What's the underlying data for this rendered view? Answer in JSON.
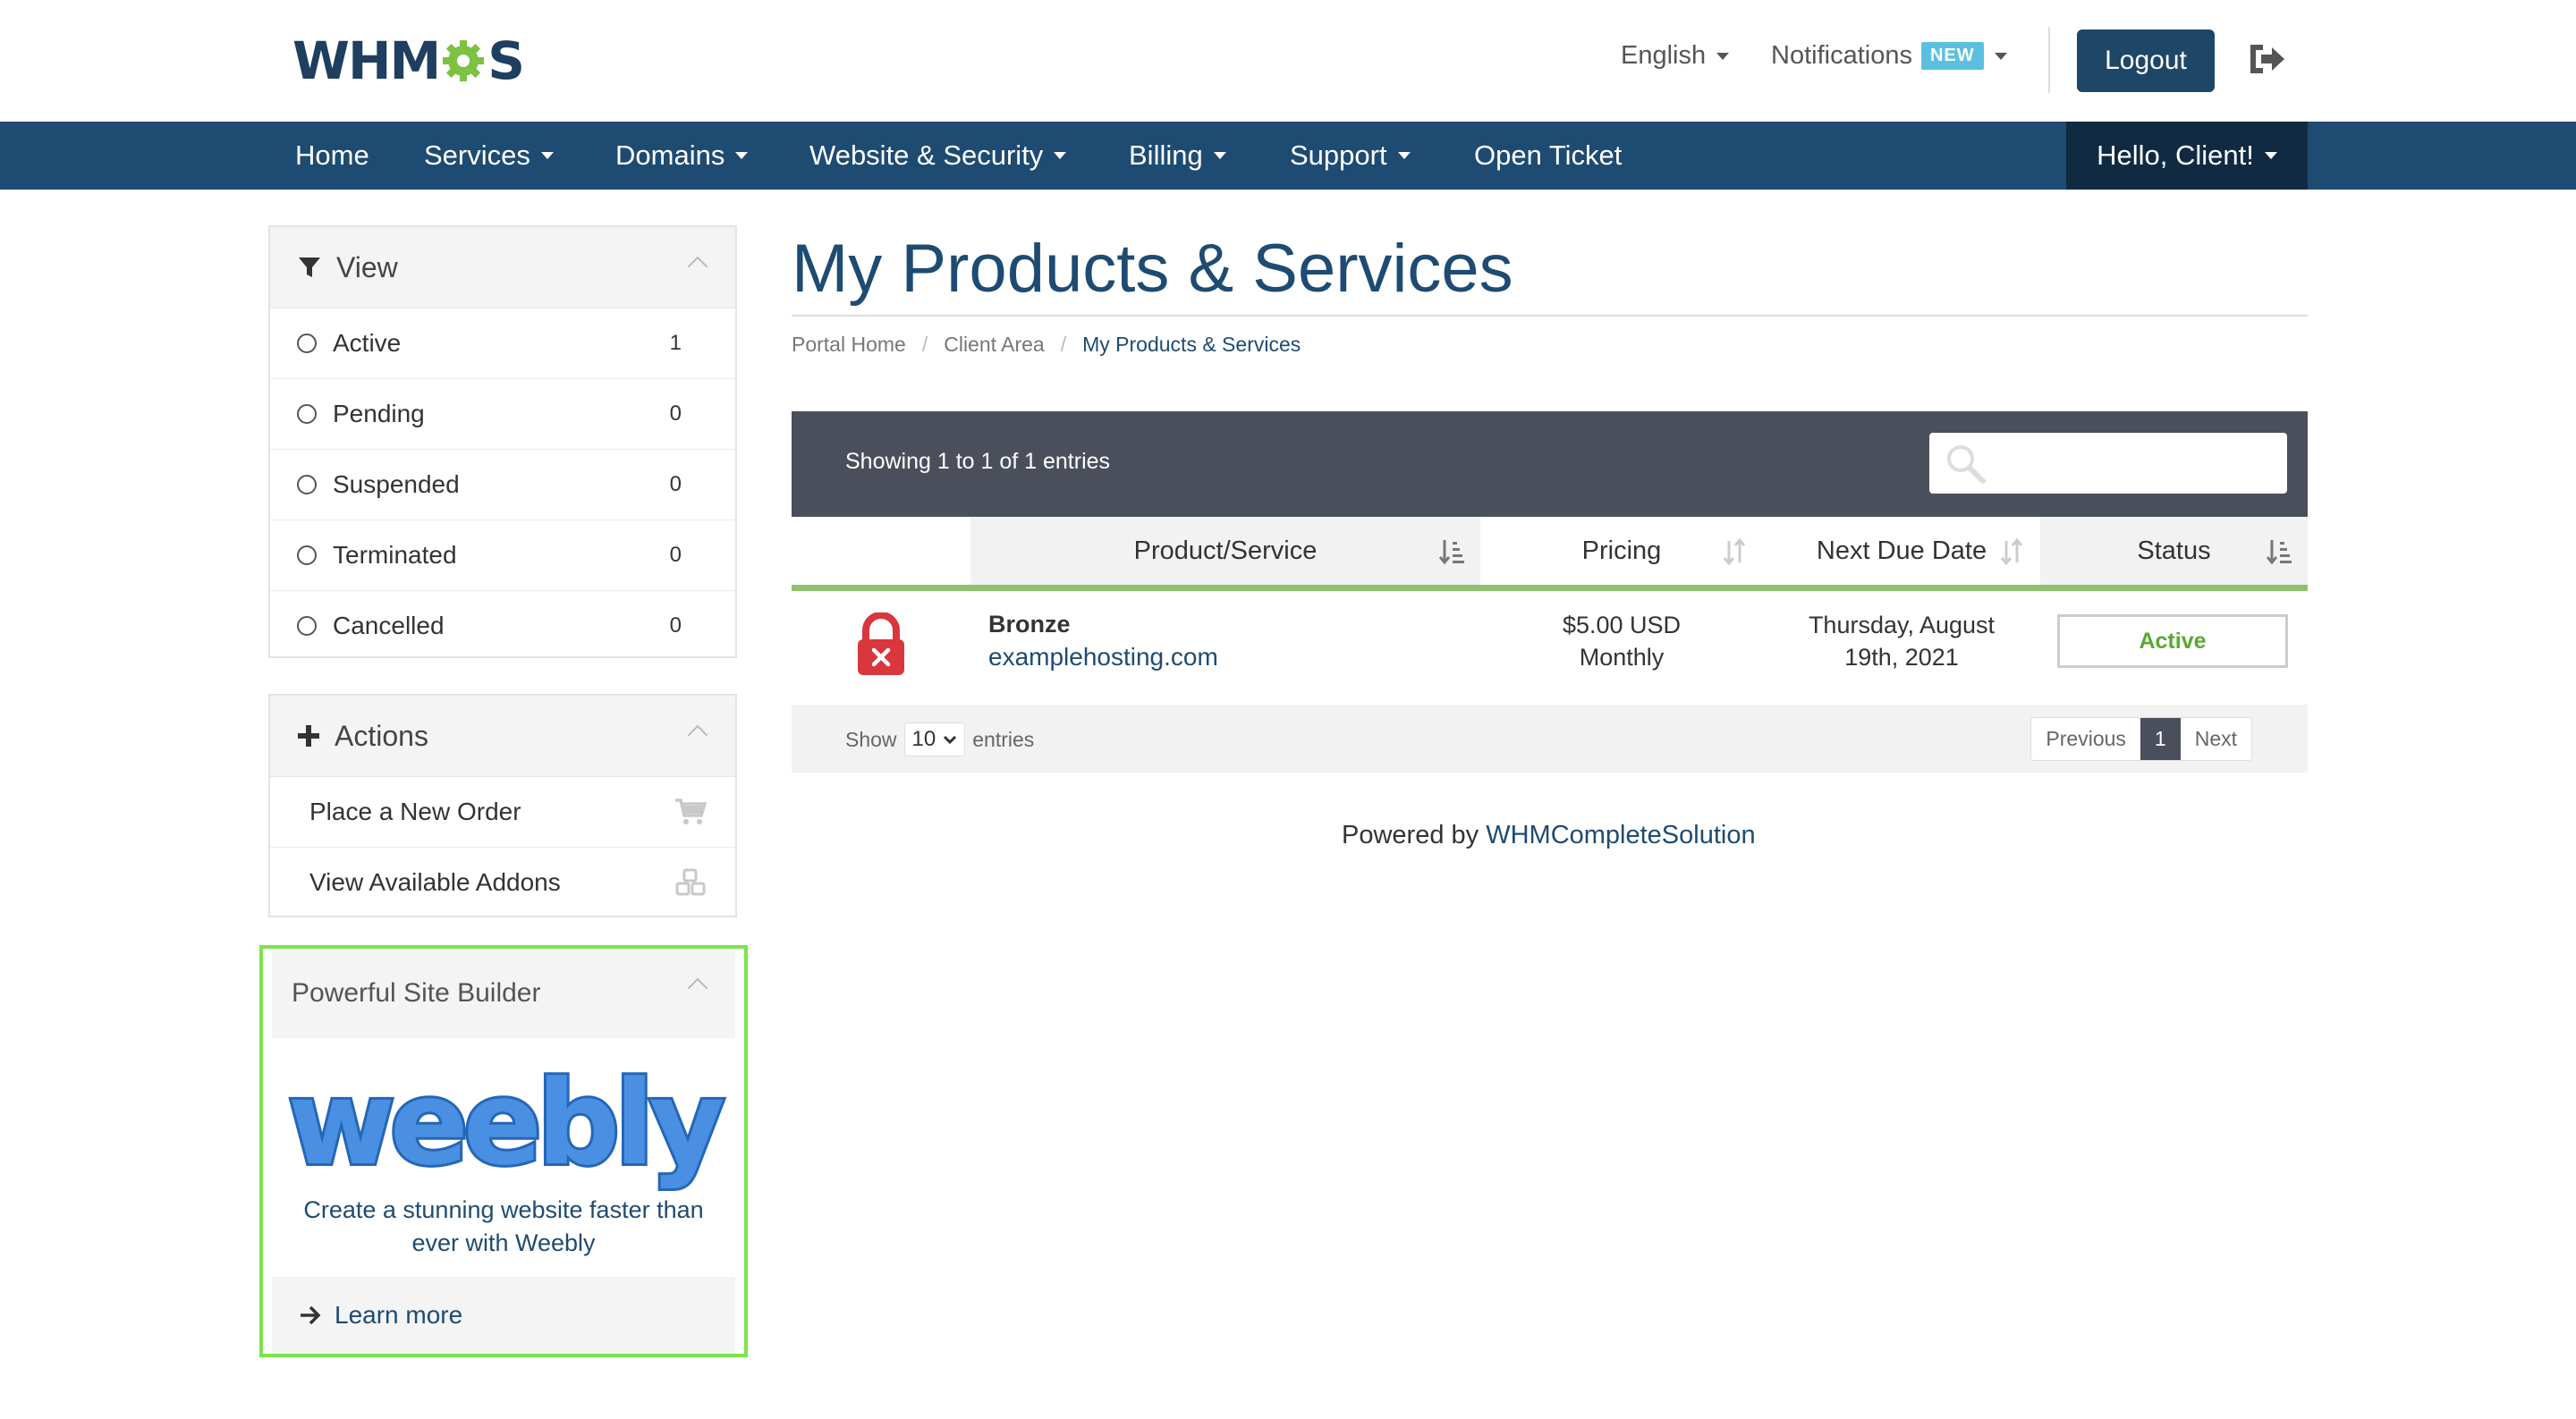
{
  "brand": {
    "logo_prefix": "WHM",
    "logo_suffix": "S",
    "gear_color": "#7cc243"
  },
  "topbar": {
    "language": "English",
    "notifications": "Notifications",
    "notifications_badge": "NEW",
    "logout": "Logout"
  },
  "nav": {
    "home": "Home",
    "services": "Services",
    "domains": "Domains",
    "website_security": "Website & Security",
    "billing": "Billing",
    "support": "Support",
    "open_ticket": "Open Ticket",
    "user": "Hello, Client!"
  },
  "sidebar": {
    "view": {
      "title": "View",
      "items": [
        {
          "label": "Active",
          "count": "1"
        },
        {
          "label": "Pending",
          "count": "0"
        },
        {
          "label": "Suspended",
          "count": "0"
        },
        {
          "label": "Terminated",
          "count": "0"
        },
        {
          "label": "Cancelled",
          "count": "0"
        }
      ]
    },
    "actions": {
      "title": "Actions",
      "items": [
        {
          "label": "Place a New Order",
          "icon": "cart-icon"
        },
        {
          "label": "View Available Addons",
          "icon": "cubes-icon"
        }
      ]
    },
    "promo": {
      "title": "Powerful Site Builder",
      "logo_text": "weebly",
      "description": "Create a stunning website faster than ever with Weebly",
      "link": "Learn more"
    }
  },
  "main": {
    "title": "My Products & Services",
    "breadcrumb": [
      "Portal Home",
      "Client Area",
      "My Products & Services"
    ],
    "table": {
      "showing": "Showing 1 to 1 of 1 entries",
      "search_placeholder": "",
      "columns": [
        "Product/Service",
        "Pricing",
        "Next Due Date",
        "Status"
      ],
      "rows": [
        {
          "product": "Bronze",
          "domain": "examplehosting.com",
          "price": "$5.00 USD",
          "cycle": "Monthly",
          "due_line1": "Thursday, August",
          "due_line2": "19th, 2021",
          "status": "Active"
        }
      ],
      "show_label": "Show",
      "page_size": "10",
      "entries_label": "entries",
      "prev": "Previous",
      "page": "1",
      "next": "Next"
    },
    "powered_prefix": "Powered by",
    "powered_link": "WHMCompleteSolution"
  },
  "colors": {
    "primary": "#1e4b72",
    "nav": "#1e4b72",
    "nav_user": "#102a42",
    "active_green": "#5aa832",
    "highlight_border": "#7ce34e"
  }
}
